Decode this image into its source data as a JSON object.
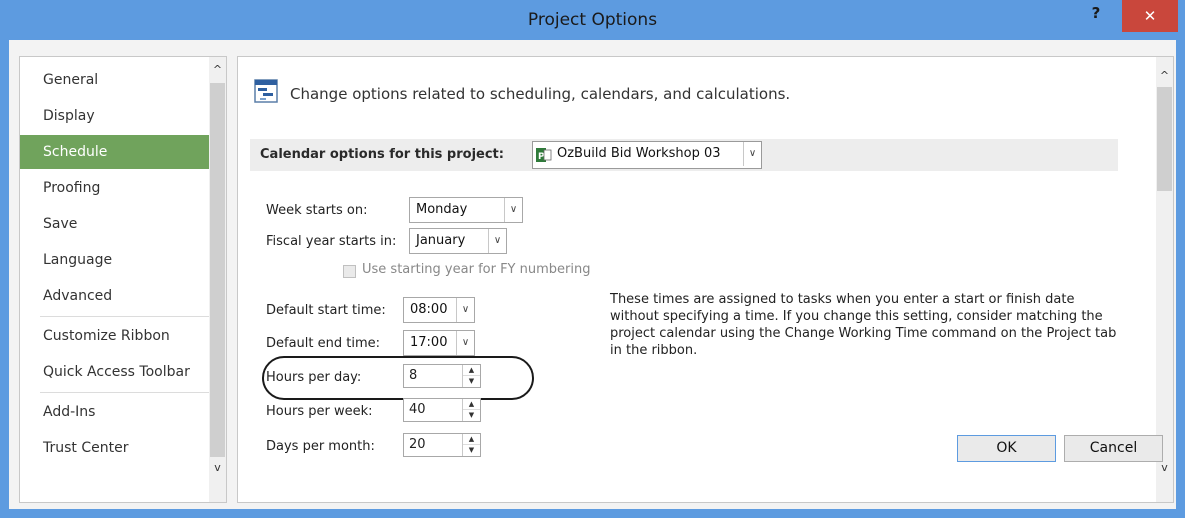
{
  "window": {
    "title": "Project Options",
    "help_label": "?",
    "close_label": "✕"
  },
  "sidebar": {
    "items": [
      {
        "label": "General"
      },
      {
        "label": "Display"
      },
      {
        "label": "Schedule",
        "active": true
      },
      {
        "label": "Proofing"
      },
      {
        "label": "Save"
      },
      {
        "label": "Language"
      },
      {
        "label": "Advanced"
      },
      {
        "label": "Customize Ribbon"
      },
      {
        "label": "Quick Access Toolbar"
      },
      {
        "label": "Add-Ins"
      },
      {
        "label": "Trust Center"
      }
    ],
    "scroll_up": "^",
    "scroll_down": "v"
  },
  "main": {
    "header_text": "Change options related to scheduling, calendars, and calculations.",
    "calendar_section_label": "Calendar options for this project:",
    "project_combo_value": "OzBuild Bid Workshop 03",
    "week_starts_label": "Week starts on:",
    "week_starts_value": "Monday",
    "fiscal_year_label": "Fiscal year starts in:",
    "fiscal_year_value": "January",
    "fy_numbering_label": "Use starting year for FY numbering",
    "default_start_label": "Default start time:",
    "default_start_value": "08:00",
    "default_end_label": "Default end time:",
    "default_end_value": "17:00",
    "hours_per_day_label": "Hours per day:",
    "hours_per_day_value": "8",
    "hours_per_week_label": "Hours per week:",
    "hours_per_week_value": "40",
    "days_per_month_label": "Days per month:",
    "days_per_month_value": "20",
    "times_description": "These times are assigned to tasks when you enter a start or finish date without specifying a time. If you change this setting, consider matching the project calendar using the Change Working Time command on the Project tab in the ribbon."
  },
  "footer": {
    "ok_label": "OK",
    "cancel_label": "Cancel"
  },
  "colors": {
    "titlebar": "#5d9be0",
    "close_button": "#c9473c",
    "active_nav": "#70a35c"
  }
}
